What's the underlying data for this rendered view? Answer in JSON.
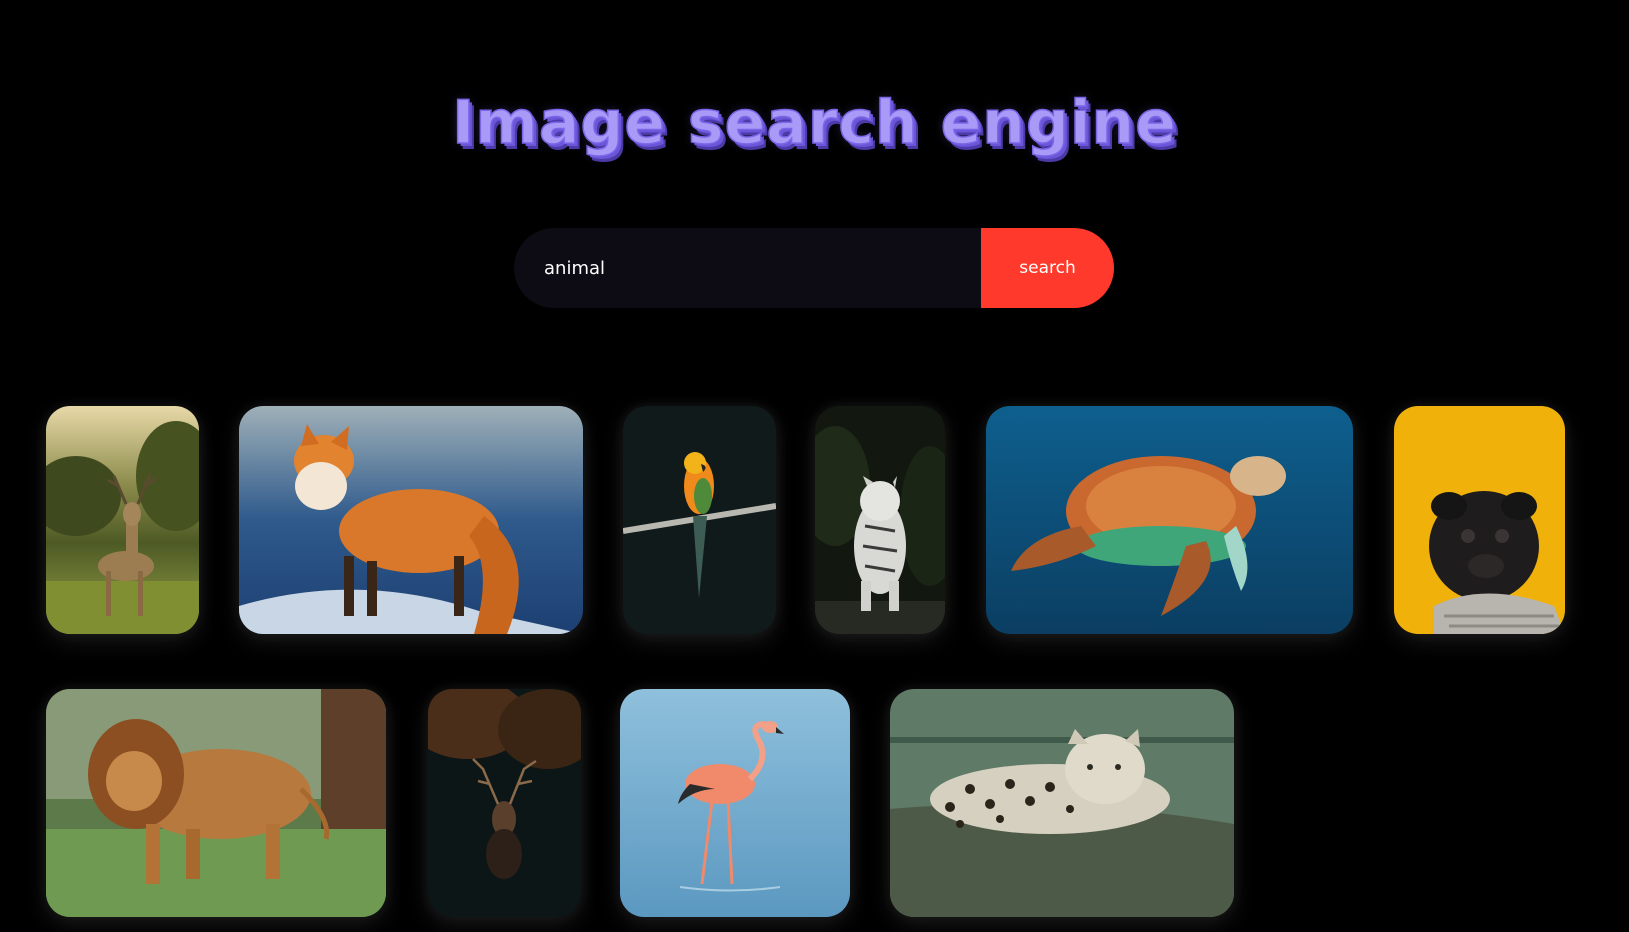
{
  "header": {
    "title": "Image search engine"
  },
  "search": {
    "value": "animal",
    "placeholder": "",
    "button_label": "search"
  },
  "colors": {
    "background": "#000000",
    "title": "#a99af7",
    "input_background": "#0d0c15",
    "search_button": "#ff3a2c"
  },
  "results": [
    {
      "subject": "deer-in-meadow",
      "icon": "deer-icon"
    },
    {
      "subject": "red-fox-in-snow",
      "icon": "fox-icon"
    },
    {
      "subject": "parrot-on-branch",
      "icon": "parrot-icon"
    },
    {
      "subject": "white-tiger-in-jungle",
      "icon": "tiger-icon"
    },
    {
      "subject": "sea-turtle-underwater",
      "icon": "turtle-icon"
    },
    {
      "subject": "pug-in-sweater",
      "icon": "dog-icon"
    },
    {
      "subject": "lion-walking-on-grass",
      "icon": "lion-icon"
    },
    {
      "subject": "stag-in-dark-forest",
      "icon": "stag-icon"
    },
    {
      "subject": "flamingo-in-water",
      "icon": "flamingo-icon"
    },
    {
      "subject": "leopard-on-log",
      "icon": "leopard-icon"
    }
  ]
}
